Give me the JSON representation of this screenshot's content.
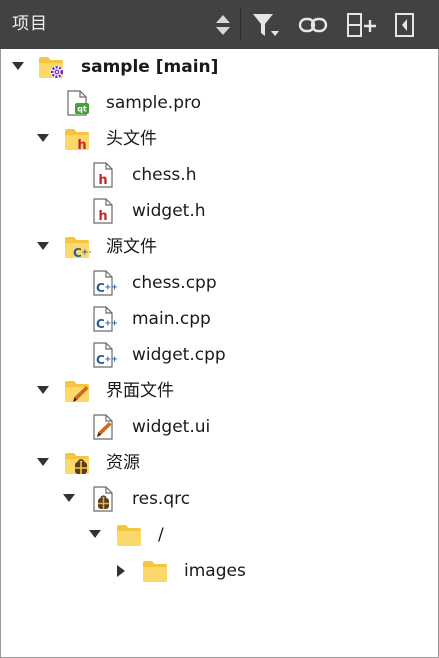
{
  "header": {
    "title": "项目",
    "icons": [
      "sort-updown-icon",
      "filter-icon",
      "link-icon",
      "split-add-icon",
      "close-pane-icon"
    ]
  },
  "tree": {
    "project": {
      "label": "sample [main]",
      "icon": "folder-gear-icon"
    },
    "pro_file": {
      "label": "sample.pro",
      "icon": "qt-pro-file-icon"
    },
    "headers": {
      "label": "头文件",
      "icon": "folder-header-icon"
    },
    "header_chess": {
      "label": "chess.h",
      "icon": "header-file-icon"
    },
    "header_widget": {
      "label": "widget.h",
      "icon": "header-file-icon"
    },
    "sources": {
      "label": "源文件",
      "icon": "folder-cpp-icon"
    },
    "source_chess": {
      "label": "chess.cpp",
      "icon": "cpp-file-icon"
    },
    "source_main": {
      "label": "main.cpp",
      "icon": "cpp-file-icon"
    },
    "source_widget": {
      "label": "widget.cpp",
      "icon": "cpp-file-icon"
    },
    "forms": {
      "label": "界面文件",
      "icon": "folder-form-icon"
    },
    "form_widget": {
      "label": "widget.ui",
      "icon": "ui-file-icon"
    },
    "resources": {
      "label": "资源",
      "icon": "folder-resource-icon"
    },
    "res_qrc": {
      "label": "res.qrc",
      "icon": "qrc-file-icon"
    },
    "res_root": {
      "label": "/",
      "icon": "folder-icon"
    },
    "res_images": {
      "label": "images",
      "icon": "folder-icon"
    }
  },
  "colors": {
    "toolbar_bg": "#404244",
    "folder": "#f5c542",
    "header_h": "#c0282e",
    "cpp_blue": "#2b5d95",
    "qt_green": "#41a535",
    "gear_purple": "#6f36b3"
  }
}
